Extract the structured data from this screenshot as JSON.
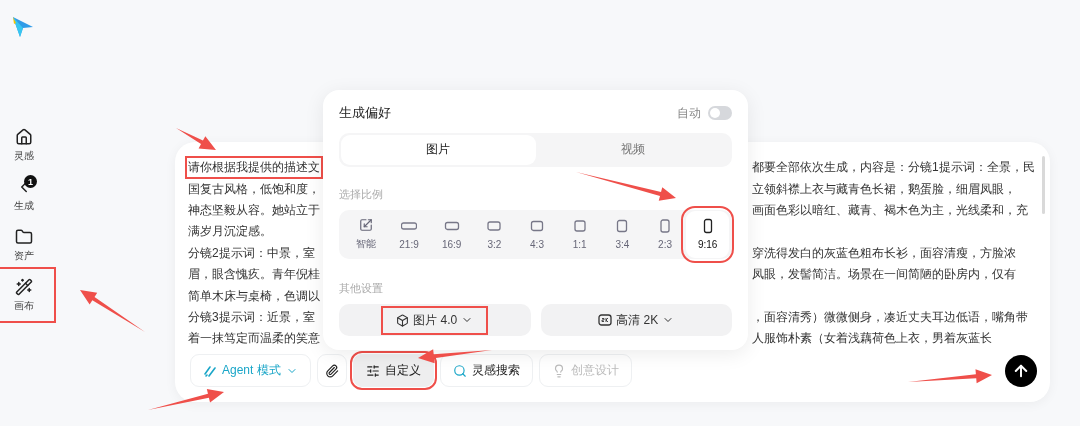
{
  "sidebar": {
    "items": [
      {
        "kind": "home",
        "label": "灵感",
        "annotated": false
      },
      {
        "kind": "generate",
        "label": "生成",
        "badge": "1",
        "annotated": false
      },
      {
        "kind": "folder",
        "label": "资产",
        "annotated": false
      },
      {
        "kind": "canvas",
        "label": "画布",
        "annotated": true
      }
    ]
  },
  "prompt": {
    "lines": [
      {
        "left": "请你根据我提供的描述文",
        "right": "都要全部依次生成，内容是：分镜1提示词：全景，民",
        "annotated": true
      },
      {
        "left": "国复古风格，低饱和度，",
        "right": "立领斜襟上衣与藏青色长裙，鹅蛋脸，细眉凤眼，"
      },
      {
        "left": "神态坚毅从容。她站立于",
        "right": "画面色彩以暗红、藏青、褐木色为主，光线柔和，充"
      },
      {
        "left": "满岁月沉淀感。"
      },
      {
        "left": "分镜2提示词：中景，室",
        "right": "穿洗得发白的灰蓝色粗布长衫，面容清瘦，方脸浓"
      },
      {
        "left": "眉，眼含愧疚。青年倪桂",
        "right": "凤眼，发髻简洁。场景在一间简陋的卧房内，仅有"
      },
      {
        "left": "简单木床与桌椅，色调以"
      },
      {
        "left": "分镜3提示词：近景，室",
        "right": "，面容清秀）微微侧身，凑近丈夫耳边低语，嘴角带"
      },
      {
        "left": "着一抹笃定而温柔的笑意",
        "right": "人服饰朴素（女着浅藕荷色上衣，男着灰蓝长"
      }
    ]
  },
  "toolbar": [
    {
      "kind": "agent",
      "label": "Agent 模式",
      "active": false,
      "disabled": false,
      "annotated": false
    },
    {
      "kind": "attach",
      "active": false,
      "disabled": false,
      "annotated": false
    },
    {
      "kind": "custom",
      "label": "自定义",
      "active": true,
      "disabled": false,
      "annotated": true
    },
    {
      "kind": "search",
      "label": "灵感搜索",
      "active": false,
      "disabled": false,
      "annotated": false
    },
    {
      "kind": "idea",
      "label": "创意设计",
      "active": false,
      "disabled": true,
      "annotated": false
    }
  ],
  "popover": {
    "title": "生成偏好",
    "auto": {
      "label": "自动",
      "on": false
    },
    "tabs": [
      {
        "label": "图片",
        "selected": true
      },
      {
        "label": "视频",
        "selected": false
      }
    ],
    "ratio_label": "选择比例",
    "ratios": [
      {
        "kind": "auto",
        "label": "智能",
        "selected": false,
        "annotated": false
      },
      {
        "kind": "ratio",
        "label": "21:9",
        "selected": false,
        "annotated": false
      },
      {
        "kind": "ratio",
        "label": "16:9",
        "selected": false,
        "annotated": false
      },
      {
        "kind": "ratio",
        "label": "3:2",
        "selected": false,
        "annotated": false
      },
      {
        "kind": "ratio",
        "label": "4:3",
        "selected": false,
        "annotated": false
      },
      {
        "kind": "ratio",
        "label": "1:1",
        "selected": false,
        "annotated": false
      },
      {
        "kind": "ratio",
        "label": "3:4",
        "selected": false,
        "annotated": false
      },
      {
        "kind": "ratio",
        "label": "2:3",
        "selected": false,
        "annotated": false
      },
      {
        "kind": "ratio",
        "label": "9:16",
        "selected": true,
        "annotated": true
      }
    ],
    "other_label": "其他设置",
    "settings": [
      {
        "kind": "model",
        "label": "图片 4.0",
        "annotated": true
      },
      {
        "kind": "quality",
        "label": "高清 2K"
      }
    ]
  }
}
